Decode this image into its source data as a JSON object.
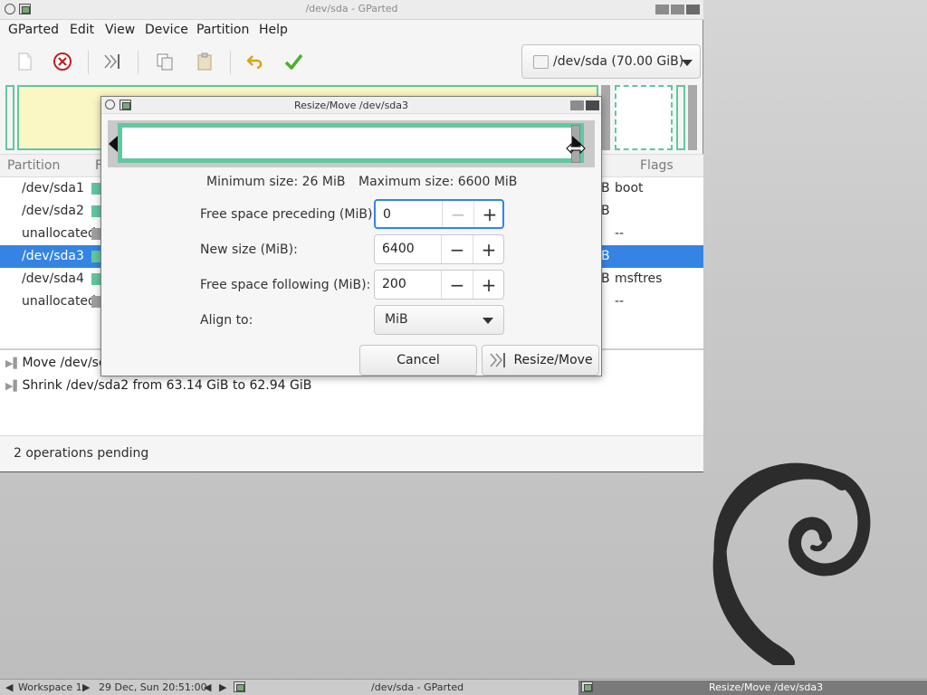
{
  "gparted": {
    "title": "/dev/sda - GParted",
    "menu": [
      "GParted",
      "Edit",
      "View",
      "Device",
      "Partition",
      "Help"
    ],
    "device_selector": "/dev/sda  (70.00 GiB)",
    "columns": {
      "partition": "Partition",
      "filesystem_cut": "F",
      "flags": "Flags"
    },
    "partitions": [
      {
        "name": "/dev/sda1",
        "color": "#63c7a0",
        "tail": "B",
        "flags": "boot"
      },
      {
        "name": "/dev/sda2",
        "color": "#63c7a0",
        "tail": "B",
        "flags": ""
      },
      {
        "name": "unallocated",
        "color": "#a0a0a0",
        "tail": "",
        "flags": "--"
      },
      {
        "name": "/dev/sda3",
        "color": "#63c7a0",
        "tail": "B",
        "flags": "",
        "selected": true
      },
      {
        "name": "/dev/sda4",
        "color": "#63c7a0",
        "tail": "B",
        "flags": "msftres"
      },
      {
        "name": "unallocated",
        "color": "#a0a0a0",
        "tail": "",
        "flags": "--"
      }
    ],
    "operations": [
      "Move /dev/sd",
      "Shrink /dev/sda2 from 63.14 GiB to 62.94 GiB"
    ],
    "status": "2 operations pending"
  },
  "dialog": {
    "title": "Resize/Move /dev/sda3",
    "min_size": "Minimum size: 26 MiB",
    "max_size": "Maximum size: 6600 MiB",
    "fields": {
      "preceding": {
        "label": "Free space preceding (MiB):",
        "value": "0"
      },
      "new_size": {
        "label": "New size (MiB):",
        "value": "6400"
      },
      "following": {
        "label": "Free space following (MiB):",
        "value": "200"
      },
      "align": {
        "label": "Align to:",
        "value": "MiB"
      }
    },
    "cancel": "Cancel",
    "resize_move": "Resize/Move"
  },
  "panel": {
    "workspace": "Workspace 1",
    "clock": "29 Dec, Sun 20:51:00",
    "task1": "/dev/sda - GParted",
    "task2": "Resize/Move /dev/sda3"
  },
  "colors": {
    "accent": "#3584e4",
    "ext4_green": "#63c7a0",
    "unallocated": "#a0a0a0"
  }
}
